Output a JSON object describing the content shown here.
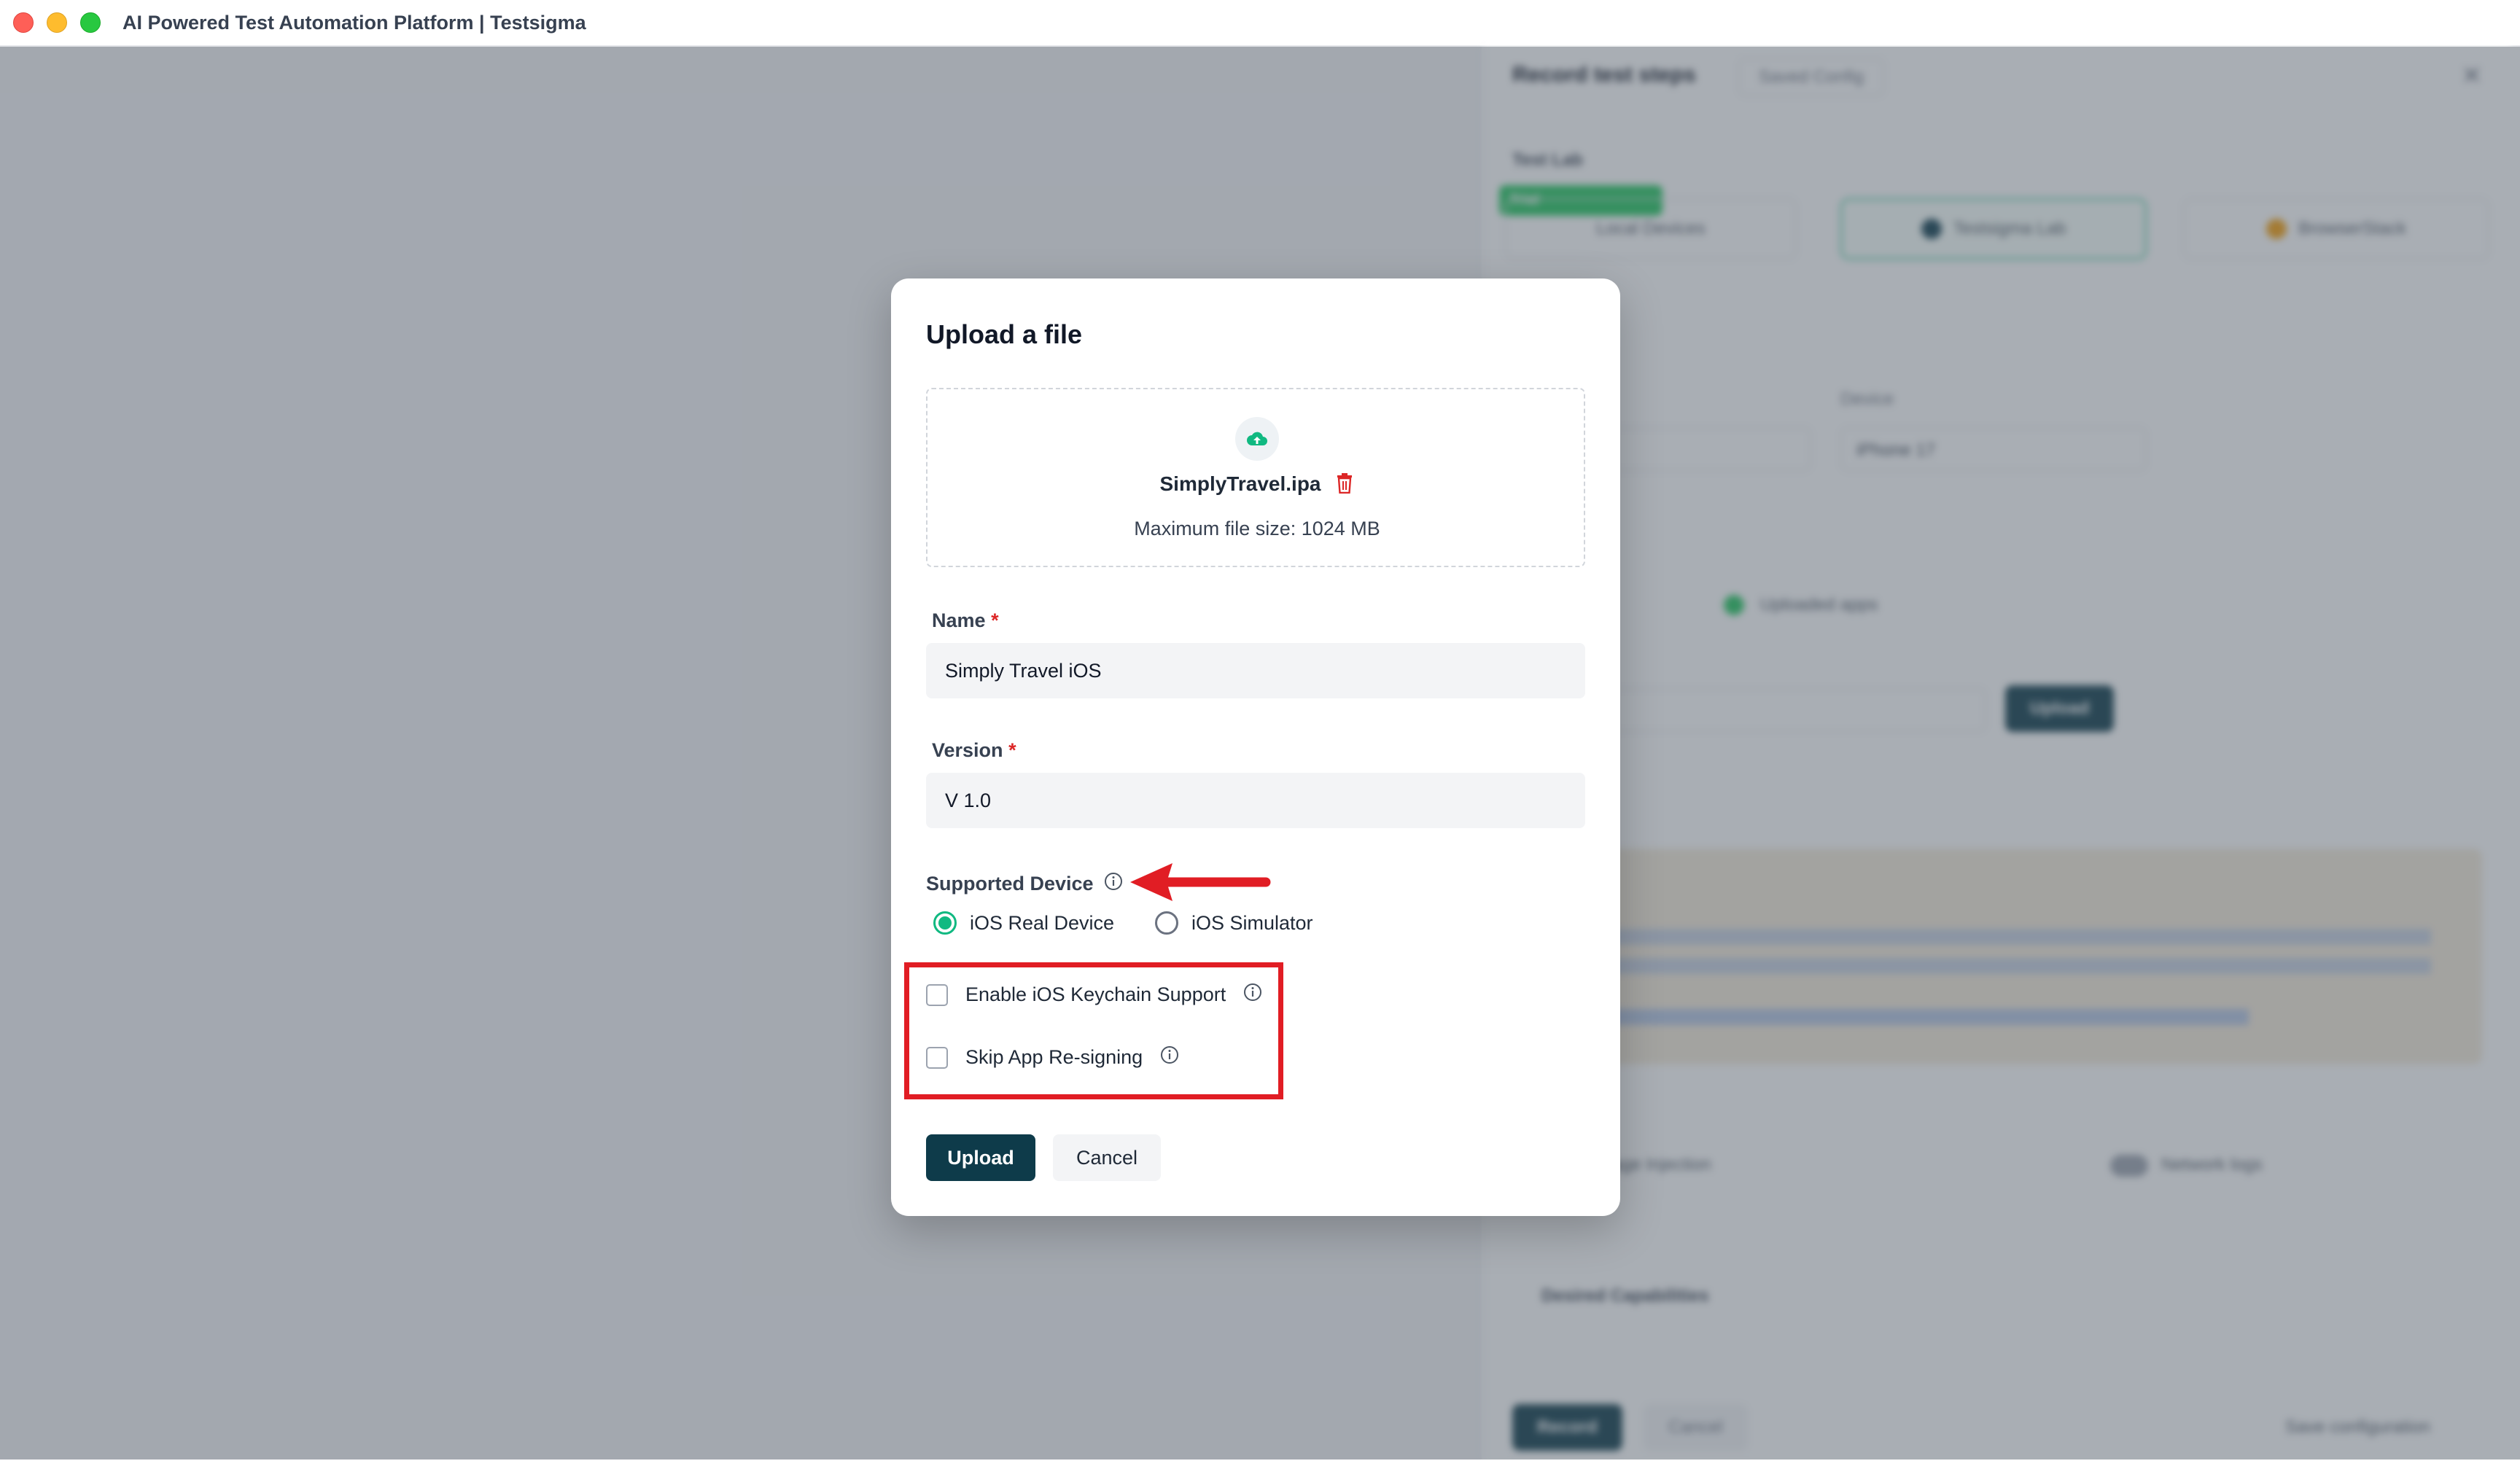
{
  "window": {
    "title": "AI Powered Test Automation Platform | Testsigma"
  },
  "background_panel": {
    "title": "Record test steps",
    "config_chip": "Saved Config",
    "test_lab_label": "Test Lab",
    "promo_tag": "Trial",
    "lab_options": [
      "Local Devices",
      "Testsigma Lab",
      "BrowserStack"
    ],
    "device_label": "Device",
    "device_value": "iPhone 17",
    "app_source_option": "Uploaded apps",
    "upload_button": "Upload",
    "record_button": "Record",
    "cancel_button": "Cancel",
    "save_config": "Save configuration",
    "desired_capabilities": "Desired Capabilities",
    "network_logs": "Network logs",
    "image_injection": "Image Injection"
  },
  "modal": {
    "title": "Upload a file",
    "dropzone": {
      "file_name": "SimplyTravel.ipa",
      "max_size": "Maximum file size: 1024 MB"
    },
    "name_label": "Name",
    "name_value": "Simply Travel iOS",
    "version_label": "Version",
    "version_value": "V 1.0",
    "required_mark": "*",
    "supported_device_label": "Supported Device",
    "device_options": [
      {
        "label": "iOS Real Device",
        "selected": true
      },
      {
        "label": "iOS Simulator",
        "selected": false
      }
    ],
    "checkboxes": [
      {
        "label": "Enable iOS Keychain Support",
        "checked": false
      },
      {
        "label": "Skip App Re-signing",
        "checked": false
      }
    ],
    "upload_button": "Upload",
    "cancel_button": "Cancel"
  },
  "colors": {
    "accent": "#10b981",
    "primary_button": "#0e3b4a",
    "annotation_red": "#e11d24",
    "required": "#dc2626"
  },
  "icons": [
    "cloud-upload-icon",
    "trash-icon",
    "info-icon",
    "annotation-arrow-icon"
  ]
}
